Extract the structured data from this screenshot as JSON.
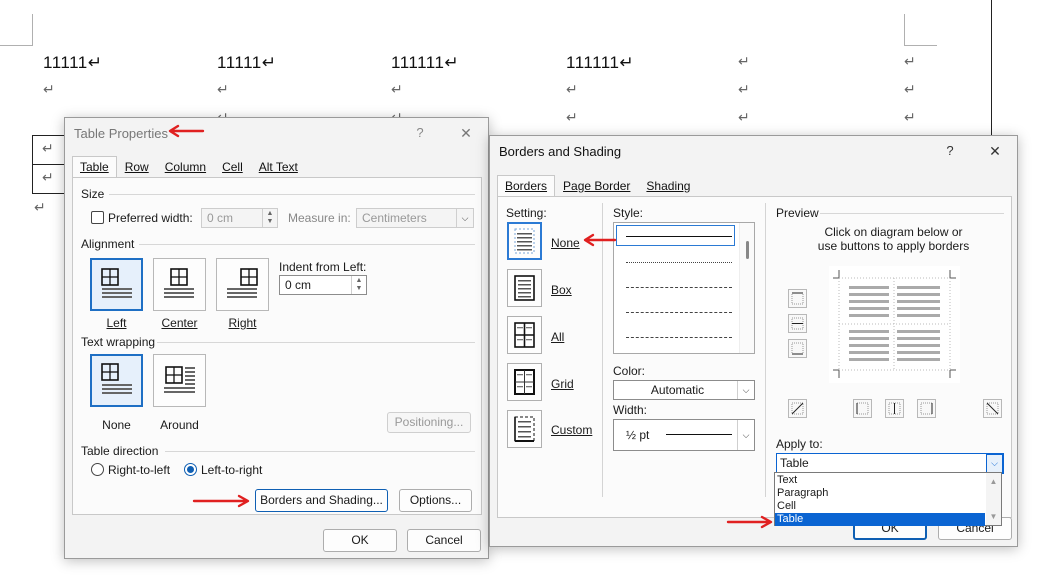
{
  "document": {
    "cells": [
      "11111↵",
      "11111↵",
      "111111↵",
      "111111↵"
    ],
    "para_mark": "↵"
  },
  "table_properties": {
    "title": "Table Properties",
    "help": "?",
    "close": "✕",
    "tabs": [
      "Table",
      "Row",
      "Column",
      "Cell",
      "Alt Text"
    ],
    "size_label": "Size",
    "preferred_width_label": "Preferred width:",
    "preferred_width_value": "0 cm",
    "measure_in_label": "Measure in:",
    "measure_in_value": "Centimeters",
    "alignment_label": "Alignment",
    "alignments": [
      "Left",
      "Center",
      "Right"
    ],
    "indent_label": "Indent from Left:",
    "indent_value": "0 cm",
    "text_wrapping_label": "Text wrapping",
    "wrap_options": [
      "None",
      "Around"
    ],
    "positioning_button": "Positioning...",
    "table_direction_label": "Table direction",
    "directions": [
      "Right-to-left",
      "Left-to-right"
    ],
    "borders_button": "Borders and Shading...",
    "options_button": "Options...",
    "ok": "OK",
    "cancel": "Cancel"
  },
  "borders_shading": {
    "title": "Borders and Shading",
    "help": "?",
    "close": "✕",
    "tabs": [
      "Borders",
      "Page Border",
      "Shading"
    ],
    "setting_label": "Setting:",
    "settings": [
      "None",
      "Box",
      "All",
      "Grid",
      "Custom"
    ],
    "style_label": "Style:",
    "color_label": "Color:",
    "color_value": "Automatic",
    "width_label": "Width:",
    "width_value": "½ pt",
    "preview_label": "Preview",
    "preview_hint": "Click on diagram below or use buttons to apply borders",
    "apply_to_label": "Apply to:",
    "apply_to_value": "Table",
    "apply_options": [
      "Text",
      "Paragraph",
      "Cell",
      "Table"
    ],
    "ok": "OK",
    "cancel": "Cancel"
  },
  "colors": {
    "accent": "#0f5fb3",
    "annotation_arrow": "#e02020",
    "list_selection": "#0a64d2"
  }
}
